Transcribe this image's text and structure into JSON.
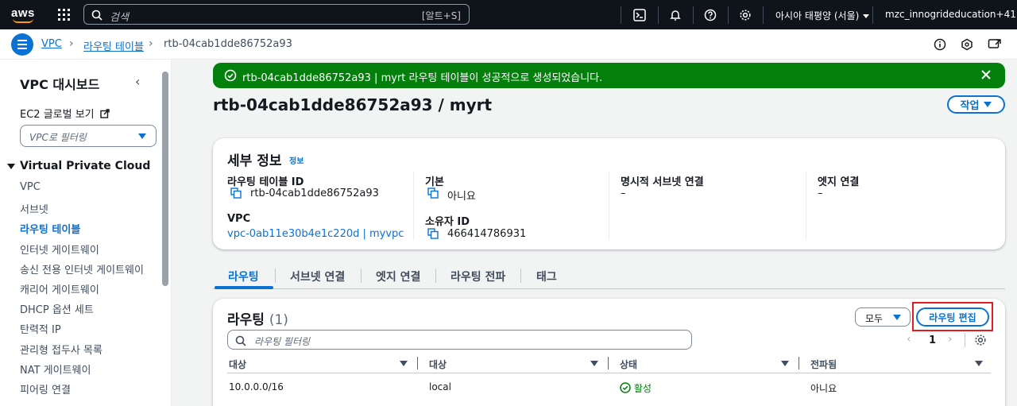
{
  "topnav": {
    "logo": "aws",
    "search_placeholder": "검색",
    "search_shortcut": "[알트+S]",
    "region": "아시아 태평양 (서울)",
    "account": "mzc_innogrideducation+41"
  },
  "breadcrumb": {
    "items": [
      "VPC",
      "라우팅 테이블",
      "rtb-04cab1dde86752a93"
    ]
  },
  "sidebar": {
    "title": "VPC 대시보드",
    "ec2_global": "EC2 글로벌 보기",
    "filter_placeholder": "VPC로 필터링",
    "section": "Virtual Private Cloud",
    "items": [
      {
        "label": "VPC",
        "active": false
      },
      {
        "label": "서브넷",
        "active": false
      },
      {
        "label": "라우팅 테이블",
        "active": true
      },
      {
        "label": "인터넷 게이트웨이",
        "active": false
      },
      {
        "label": "송신 전용 인터넷 게이트웨이",
        "active": false
      },
      {
        "label": "캐리어 게이트웨이",
        "active": false
      },
      {
        "label": "DHCP 옵션 세트",
        "active": false
      },
      {
        "label": "탄력적 IP",
        "active": false
      },
      {
        "label": "관리형 접두사 목록",
        "active": false
      },
      {
        "label": "NAT 게이트웨이",
        "active": false
      },
      {
        "label": "피어링 연결",
        "active": false
      }
    ]
  },
  "flash": {
    "message": "rtb-04cab1dde86752a93 | myrt 라우팅 테이블이 성공적으로 생성되었습니다.",
    "color": "#037f0c"
  },
  "page": {
    "title": "rtb-04cab1dde86752a93 / myrt",
    "actions_label": "작업"
  },
  "details": {
    "title": "세부 정보",
    "info": "정보",
    "route_table_id_label": "라우팅 테이블 ID",
    "route_table_id": "rtb-04cab1dde86752a93",
    "main_label": "기본",
    "main_value": "아니요",
    "explicit_subnet_label": "명시적 서브넷 연결",
    "explicit_subnet_value": "–",
    "edge_label": "엣지 연결",
    "edge_value": "–",
    "vpc_label": "VPC",
    "vpc_value": "vpc-0ab11e30b4e1c220d | myvpc",
    "owner_label": "소유자 ID",
    "owner_value": "466414786931"
  },
  "tabs": [
    "라우팅",
    "서브넷 연결",
    "엣지 연결",
    "라우팅 전파",
    "태그"
  ],
  "routes": {
    "title": "라우팅",
    "count": "(1)",
    "select_label": "모두",
    "edit_label": "라우팅 편집",
    "filter_placeholder": "라우팅 필터링",
    "page": "1",
    "columns": [
      "대상",
      "대상",
      "상태",
      "전파됨"
    ],
    "rows": [
      {
        "destination": "10.0.0.0/16",
        "target": "local",
        "status": "활성",
        "propagated": "아니요"
      }
    ]
  },
  "colors": {
    "accent": "#0972d3",
    "nav_bg": "#0f141a",
    "highlight": "#e31b23"
  }
}
